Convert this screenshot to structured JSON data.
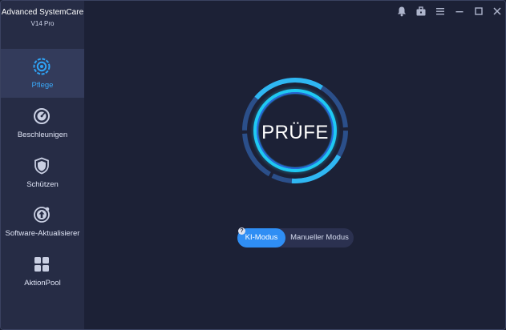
{
  "app": {
    "title": "Advanced SystemCare",
    "version": "V14  Pro"
  },
  "sidebar": {
    "items": [
      {
        "label": "Pflege",
        "icon": "care-gear-icon",
        "active": true
      },
      {
        "label": "Beschleunigen",
        "icon": "speedometer-icon",
        "active": false
      },
      {
        "label": "Schützen",
        "icon": "shield-icon",
        "active": false
      },
      {
        "label": "Software-Aktualisierer",
        "icon": "update-arrow-icon",
        "active": false
      },
      {
        "label": "AktionPool",
        "icon": "grid-apps-icon",
        "active": false
      }
    ]
  },
  "titlebar": {
    "icons": [
      "notification-bell-icon",
      "toolbox-icon",
      "menu-icon",
      "minimize-icon",
      "maximize-icon",
      "close-icon"
    ]
  },
  "scan": {
    "label": "PRÜFE"
  },
  "mode": {
    "ai_label": "KI-Modus",
    "manual_label": "Manueller Modus",
    "help": "?"
  },
  "colors": {
    "accent": "#2f8ef4",
    "ring_cyan": "#22d3f5",
    "ring_outer": "#2a4a80",
    "sidebar_bg": "#262c45",
    "sidebar_active": "#333b5b",
    "main_bg": "#1c2136"
  }
}
